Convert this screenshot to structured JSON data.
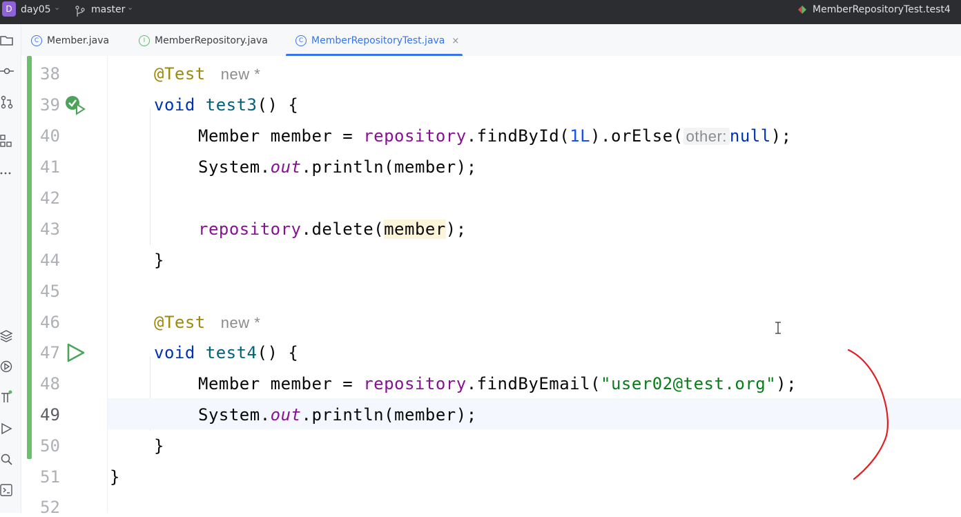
{
  "titlebar": {
    "project_badge": "D",
    "project": "day05",
    "branch": "master",
    "run_config": "MemberRepositoryTest.test4"
  },
  "tabs": [
    {
      "label": "Member.java",
      "icon": "C"
    },
    {
      "label": "MemberRepository.java",
      "icon": "I"
    },
    {
      "label": "MemberRepositoryTest.java",
      "icon": "C",
      "close": "×"
    }
  ],
  "editor": {
    "line_numbers": [
      "38",
      "39",
      "40",
      "41",
      "42",
      "43",
      "44",
      "45",
      "46",
      "47",
      "48",
      "49",
      "50",
      "51",
      "52"
    ],
    "current_line": "49",
    "inlay": {
      "new_hint": "new *",
      "param_hint": "other:"
    },
    "tokens": {
      "annotation": "@Test",
      "void": "void",
      "test3": "test3",
      "test4": "test4",
      "paren_brace": "() {",
      "member_decl": "Member member = ",
      "repository": "repository",
      "find_by_id": ".findById(",
      "one_l": "1L",
      "or_else": ").orElse(",
      "null_kw": "null",
      "close_semicolon": ");",
      "system": "System.",
      "out": "out",
      "println": ".println(member);",
      "delete": ".delete(",
      "member": "member",
      "find_by_email": ".findByEmail(",
      "email": "\"user02@test.org\"",
      "close_brace": "}"
    }
  },
  "colors": {
    "accent": "#3574f0",
    "change_bar": "#6bc06b",
    "annotation": "#9e880d",
    "keyword": "#0033b3",
    "string": "#067d17",
    "field": "#871094"
  }
}
